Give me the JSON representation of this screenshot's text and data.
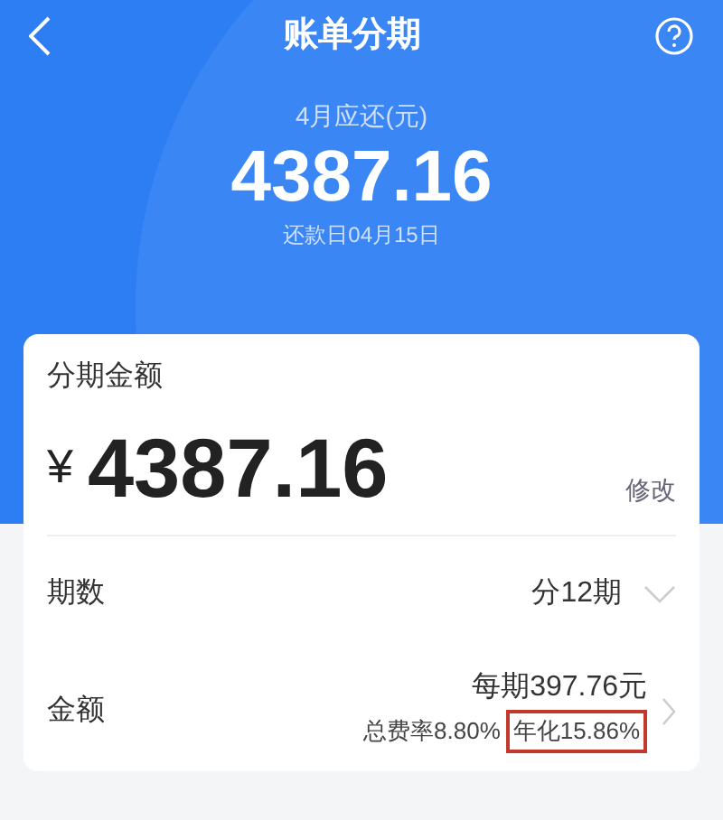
{
  "header": {
    "title": "账单分期"
  },
  "summary": {
    "label": "4月应还(元)",
    "amount": "4387.16",
    "due": "还款日04月15日"
  },
  "card": {
    "title": "分期金额",
    "currency": "¥",
    "amount": "4387.16",
    "edit": "修改",
    "rows": [
      {
        "kind": "select",
        "label": "期数",
        "value": "分12期"
      },
      {
        "kind": "detail",
        "label": "金额",
        "value": "每期397.76元",
        "rate": "总费率8.80%",
        "annual": "年化15.86%",
        "annual_highlighted": true
      }
    ]
  }
}
